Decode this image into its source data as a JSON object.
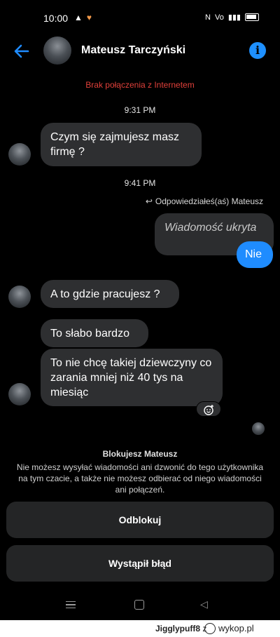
{
  "status_bar": {
    "time": "10:00",
    "icons": [
      "warning-icon",
      "heart-icon",
      "nfc-icon",
      "volte-icon",
      "signal-icon",
      "battery-icon"
    ]
  },
  "header": {
    "name": "Mateusz Tarczyński"
  },
  "connection_banner": "Brak połączenia z Internetem",
  "timestamps": [
    "9:31 PM",
    "9:41 PM"
  ],
  "messages": [
    {
      "from": "them",
      "text": "Czym się zajmujesz masz firmę ?"
    },
    {
      "from": "me",
      "text": "Wiadomość ukryta",
      "hidden": true
    },
    {
      "from": "me",
      "text": "Nie"
    },
    {
      "from": "them",
      "text": "A to gdzie pracujesz ?"
    },
    {
      "from": "them",
      "text": "To słabo bardzo"
    },
    {
      "from": "them",
      "text": "To nie chcę takiej dziewczyny co zarania mniej niż 40 tys na miesiąc"
    }
  ],
  "reply_label": "Odpowiedziałeś(aś) Mateusz",
  "block_notice": {
    "title": "Blokujesz Mateusz",
    "description": "Nie możesz wysyłać wiadomości ani dzwonić do tego użytkownika na tym czacie, a także nie możesz odbierać od niego wiadomości ani połączeń."
  },
  "buttons": {
    "unblock": "Odblokuj",
    "error": "Wystąpił błąd"
  },
  "footer": {
    "user": "Jigglypuff8",
    "separator": "z",
    "brand": "wykop.pl"
  },
  "colors": {
    "accent": "#1f8cff",
    "bubble_them": "#2e2f31",
    "error_red": "#e0403a",
    "background": "#000000"
  }
}
